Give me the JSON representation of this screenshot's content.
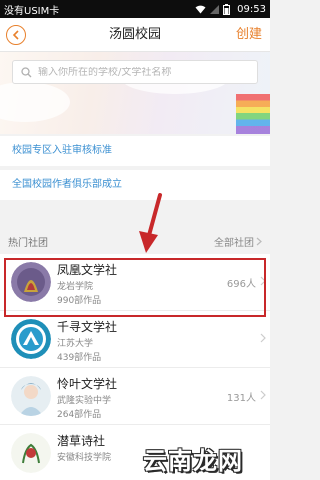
{
  "status_bar": {
    "carrier": "没有USIM卡",
    "time": "09:53"
  },
  "nav": {
    "title": "汤圆校园",
    "create_label": "创建"
  },
  "search": {
    "placeholder": "输入你所在的学校/文学社名称"
  },
  "links": [
    {
      "label": "校园专区入驻审核标准"
    },
    {
      "label": "全国校园作者俱乐部成立"
    }
  ],
  "section": {
    "title": "热门社团",
    "all_label": "全部社团"
  },
  "clubs": [
    {
      "name": "凤凰文学社",
      "school": "龙岩学院",
      "works": "990部作品",
      "members": "696人"
    },
    {
      "name": "千寻文学社",
      "school": "江苏大学",
      "works": "439部作品",
      "members": ""
    },
    {
      "name": "怜叶文学社",
      "school": "武隆实验中学",
      "works": "264部作品",
      "members": "131人"
    },
    {
      "name": "潜草诗社",
      "school": "安徽科技学院",
      "works": "",
      "members": ""
    }
  ],
  "watermark": "云南龙网",
  "colors": {
    "accent": "#e8812d",
    "link": "#3a8fd1",
    "highlight": "#c8282a"
  }
}
